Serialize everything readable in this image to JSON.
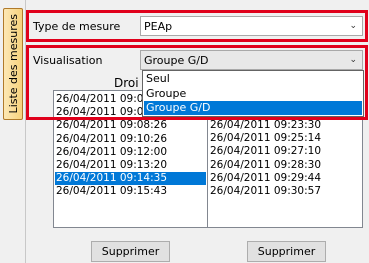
{
  "side_tab": {
    "label": "Liste des mesures"
  },
  "measure_type": {
    "label": "Type de mesure",
    "value": "PEAp"
  },
  "visualisation": {
    "label": "Visualisation",
    "value": "Groupe G/D",
    "options": [
      "Seul",
      "Groupe",
      "Groupe G/D"
    ],
    "selected_option": "Groupe G/D"
  },
  "left_list": {
    "header": "Droi",
    "items": [
      "26/04/2011 09:0",
      "26/04/2011 09:0",
      "26/04/2011 09:08:26",
      "26/04/2011 09:10:26",
      "26/04/2011 09:12:00",
      "26/04/2011 09:13:20",
      "26/04/2011 09:14:35",
      "26/04/2011 09:15:43"
    ],
    "selected_index": 6
  },
  "right_list": {
    "items": [
      "26/04/2011 09:23:30",
      "26/04/2011 09:25:14",
      "26/04/2011 09:27:10",
      "26/04/2011 09:28:30",
      "26/04/2011 09:29:44",
      "26/04/2011 09:30:57"
    ]
  },
  "buttons": {
    "delete_left": "Supprimer",
    "delete_right": "Supprimer"
  },
  "colors": {
    "selection": "#0078d7",
    "highlight_border": "#e0001b",
    "tab_fill": "#f6d27c"
  }
}
